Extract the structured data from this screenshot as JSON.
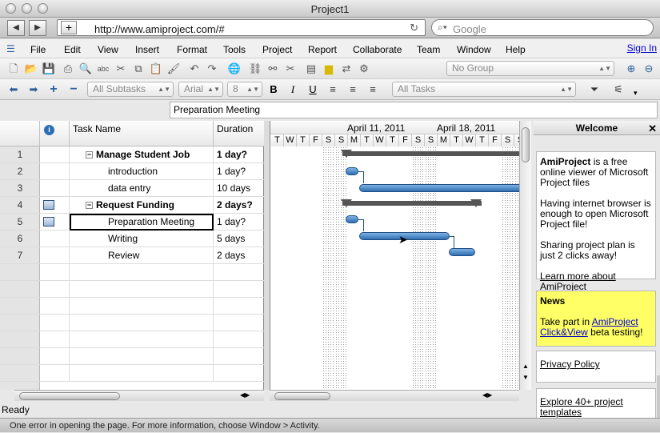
{
  "window": {
    "title": "Project1"
  },
  "browser": {
    "url": "http://www.amiproject.com/#",
    "search_placeholder": "Google"
  },
  "menu": {
    "items": [
      "File",
      "Edit",
      "View",
      "Insert",
      "Format",
      "Tools",
      "Project",
      "Report",
      "Collaborate",
      "Team",
      "Window",
      "Help"
    ],
    "signin": "Sign In"
  },
  "toolbar": {
    "group_combo": "No Group",
    "subtasks_combo": "All Subtasks",
    "font_combo": "Arial",
    "size_combo": "8",
    "filter_combo": "All Tasks",
    "bold": "B",
    "italic": "I",
    "underline": "U"
  },
  "formula_bar": {
    "value": "Preparation Meeting"
  },
  "grid": {
    "headers": {
      "info": "i",
      "name": "Task Name",
      "duration": "Duration"
    },
    "rows": [
      {
        "num": "1",
        "name": "Manage Student Job",
        "duration": "1 day?",
        "summary": true,
        "note": false
      },
      {
        "num": "2",
        "name": "introduction",
        "duration": "1 day?",
        "summary": false,
        "note": false
      },
      {
        "num": "3",
        "name": "data entry",
        "duration": "10 days",
        "summary": false,
        "note": false
      },
      {
        "num": "4",
        "name": "Request Funding",
        "duration": "2 days?",
        "summary": true,
        "note": true
      },
      {
        "num": "5",
        "name": "Preparation Meeting",
        "duration": "1 day?",
        "summary": false,
        "note": true
      },
      {
        "num": "6",
        "name": "Writing",
        "duration": "5 days",
        "summary": false,
        "note": false
      },
      {
        "num": "7",
        "name": "Review",
        "duration": "2 days",
        "summary": false,
        "note": false
      }
    ],
    "selected_row": 5
  },
  "gantt": {
    "weeks": [
      "April 11, 2011",
      "April 18, 2011"
    ],
    "days": [
      "T",
      "W",
      "T",
      "F",
      "S",
      "S",
      "M",
      "T",
      "W",
      "T",
      "F",
      "S",
      "S",
      "M",
      "T",
      "W",
      "T",
      "F",
      "S",
      "S"
    ]
  },
  "panel": {
    "title": "Welcome",
    "intro_brand": "AmiProject",
    "intro_rest": " is a free online viewer of Microsoft Project files",
    "p2": "Having internet browser is enough to open Microsoft Project file!",
    "p3": "Sharing project plan is just 2 clicks away!",
    "learn_more": "Learn more about AmiProject",
    "news_title": "News",
    "news_prefix": "Take part in ",
    "news_link": "AmiProject Click&View",
    "news_suffix": " beta testing!",
    "privacy": "Privacy Policy",
    "explore": "Explore 40+ project templates"
  },
  "status": {
    "ready": "Ready",
    "bottom": "One error in opening the page. For more information, choose Window > Activity."
  }
}
